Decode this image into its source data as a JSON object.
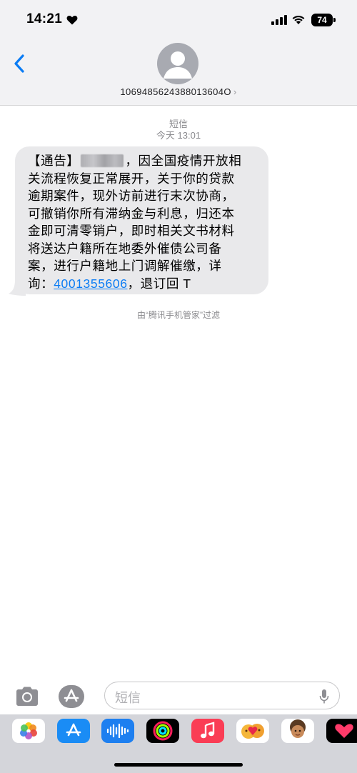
{
  "status_bar": {
    "time": "14:21",
    "battery": "74"
  },
  "header": {
    "contact_number": "1069485624388013604O",
    "chevron": "›"
  },
  "thread": {
    "service_label": "短信",
    "timestamp": "今天 13:01",
    "message": {
      "line1_prefix": "【通告】",
      "line1_suffix": "，因全国疫情开放相",
      "line2": "关流程恢复正常展开，关于你的贷款",
      "line3": "逾期案件，现外访前进行末次协商，",
      "line4": "可撤销你所有滞纳金与利息，归还本",
      "line5": "金即可清零销户，即时相关文书材料",
      "line6": "将送达户籍所在地委外催债公司备",
      "line7": "案，进行户籍地上门调解催缴，详",
      "line8_prefix": "询：",
      "line8_phone": "4001355606",
      "line8_suffix": "，退订回 T"
    },
    "filter_note": "由“腾讯手机管家”过滤"
  },
  "composer": {
    "placeholder": "短信"
  },
  "app_strip": {
    "icons": [
      "photos-icon",
      "app-store-icon",
      "audio-message-icon",
      "fitness-icon",
      "music-icon",
      "memoji-stickers-icon",
      "memoji-icon",
      "digital-touch-icon"
    ]
  },
  "colors": {
    "accent": "#0a7cf5",
    "bubble": "#e9e9eb",
    "header_bg": "#f2f2f4",
    "app_strip_bg": "#d4d5da"
  }
}
